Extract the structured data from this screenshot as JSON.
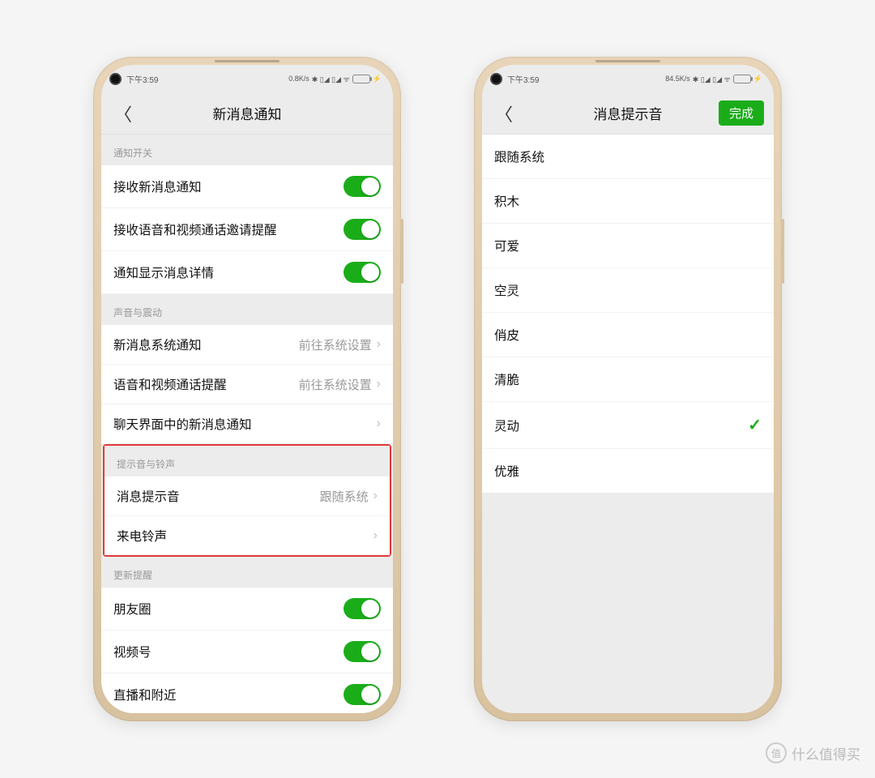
{
  "status": {
    "time": "下午3:59",
    "speed1": "0.8K/s",
    "speed2": "84.5K/s",
    "icons": "ᛒ ᴴᴰ📶 ᴴᴰ📶 ᯤ"
  },
  "phone1": {
    "title": "新消息通知",
    "section1": {
      "header": "通知开关",
      "rows": [
        {
          "label": "接收新消息通知"
        },
        {
          "label": "接收语音和视频通话邀请提醒"
        },
        {
          "label": "通知显示消息详情"
        }
      ]
    },
    "section2": {
      "header": "声音与震动",
      "rows": [
        {
          "label": "新消息系统通知",
          "value": "前往系统设置"
        },
        {
          "label": "语音和视频通话提醒",
          "value": "前往系统设置"
        },
        {
          "label": "聊天界面中的新消息通知",
          "value": ""
        }
      ]
    },
    "section3": {
      "header": "提示音与铃声",
      "rows": [
        {
          "label": "消息提示音",
          "value": "跟随系统"
        },
        {
          "label": "来电铃声",
          "value": ""
        }
      ]
    },
    "section4": {
      "header": "更新提醒",
      "rows": [
        {
          "label": "朋友圈"
        },
        {
          "label": "视频号"
        },
        {
          "label": "直播和附近"
        }
      ]
    }
  },
  "phone2": {
    "title": "消息提示音",
    "done": "完成",
    "sounds": [
      {
        "label": "跟随系统",
        "selected": false
      },
      {
        "label": "积木",
        "selected": false
      },
      {
        "label": "可爱",
        "selected": false
      },
      {
        "label": "空灵",
        "selected": false
      },
      {
        "label": "俏皮",
        "selected": false
      },
      {
        "label": "清脆",
        "selected": false
      },
      {
        "label": "灵动",
        "selected": true
      },
      {
        "label": "优雅",
        "selected": false
      }
    ]
  },
  "watermark": {
    "icon": "值",
    "text": "什么值得买"
  }
}
